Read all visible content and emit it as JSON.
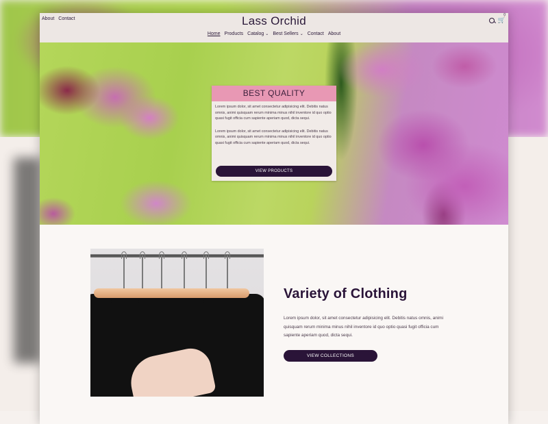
{
  "header": {
    "top_links": [
      "About",
      "Contact"
    ],
    "brand": "Lass Orchid",
    "nav": [
      {
        "label": "Home",
        "active": true,
        "dropdown": false
      },
      {
        "label": "Products",
        "active": false,
        "dropdown": false
      },
      {
        "label": "Catalog",
        "active": false,
        "dropdown": true
      },
      {
        "label": "Best Sellers",
        "active": false,
        "dropdown": true
      },
      {
        "label": "Contact",
        "active": false,
        "dropdown": false
      },
      {
        "label": "About",
        "active": false,
        "dropdown": false
      }
    ],
    "icons": [
      "search-icon",
      "cart-icon"
    ],
    "cart_count": "0"
  },
  "hero": {
    "title": "BEST QUALITY",
    "paragraphs": [
      "Lorem ipsum dolor, sit amet consectetur adipisicing elit. Debitis natus omnis, animi quisquam rerum minima minus nihil inventore id quo optio quasi fugit officia cum sapiente aperiam quod, dicta sequi.",
      "Lorem ipsum dolor, sit amet consectetur adipisicing elit. Debitis natus omnis, animi quisquam rerum minima minus nihil inventore id quo optio quasi fugit officia cum sapiente aperiam quod, dicta sequi."
    ],
    "button": "VIEW PRODUCTS"
  },
  "feature": {
    "title": "Variety of Clothing",
    "text": "Lorem ipsum dolor, sit amet consectetur adipisicing elit. Debitis natus omnis, animi quisquam rerum minima minus nihil inventore id quo optio quasi fugit officia cum sapiente aperiam quod, dicta sequi.",
    "button": "VIEW COLLECTIONS"
  },
  "colors": {
    "accent_dark": "#2a1438",
    "hero_title_bg": "#e898b4",
    "header_bg": "#ede7e4"
  }
}
